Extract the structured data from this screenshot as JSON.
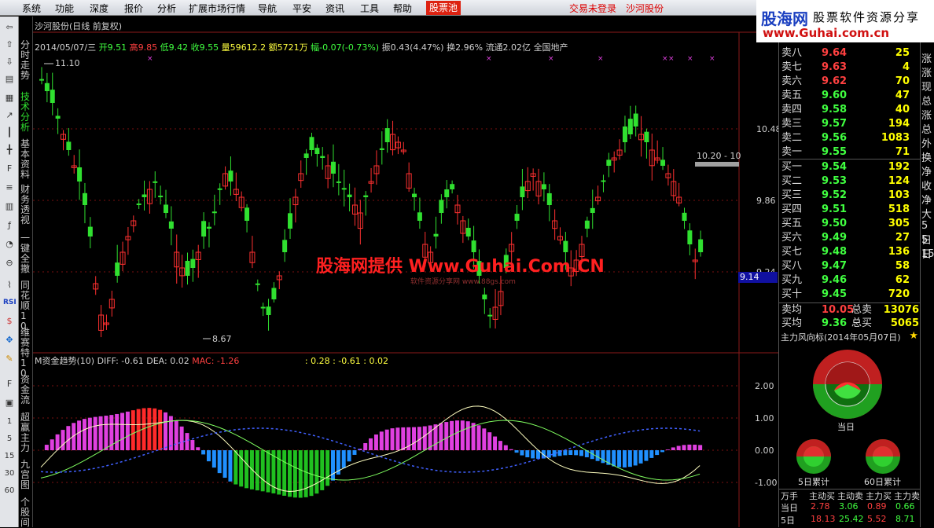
{
  "menu": [
    "系统",
    "功能",
    "深度",
    "报价",
    "分析",
    "扩展市场行情",
    "导航",
    "平安",
    "资讯",
    "工具",
    "帮助"
  ],
  "menu_active": "股票池",
  "menu_red": [
    "交易未登录",
    "沙河股份"
  ],
  "brand": {
    "b1": "股海网",
    "b2": "股票软件资源分享",
    "b3": "www.Guhai.com.cn"
  },
  "side_tabs": [
    "分时走势",
    "技术分析",
    "基本资料",
    "财务透视",
    "一键全撤",
    "同花顺10",
    "维赛特10",
    "资金流",
    "超赢主力",
    "九宫图",
    "个股间"
  ],
  "side_numbers": [
    "1",
    "5",
    "15",
    "30",
    "60"
  ],
  "chart": {
    "title": "沙河股份(日线 前复权)",
    "date": "2014/05/07/三",
    "open": "开9.51",
    "high": "高9.85",
    "low": "低9.42",
    "close": "收9.55",
    "vol": "量59612.2",
    "amt": "额5721万",
    "chg": "幅-0.07(-0.73%)",
    "amp": "振0.43(4.47%)",
    "turn": "换2.96%",
    "flow": "流通2.02亿",
    "sector": "全国地产",
    "price_ticks": [
      "10.48",
      "9.86",
      "9.24"
    ],
    "high_mark": "11.10",
    "low_mark": "8.67",
    "right_label": "10.20 - 10",
    "current_price": "9.14",
    "watermark": "股海网提供 Www.Guhai.Com.CN",
    "watermark2": "软件资源分享网 www.88gs.com",
    "ind_title": "M资金趋势(10)",
    "diff": "DIFF: -0.61",
    "dea": "DEA: 0.02",
    "mac": "MAC: -1.26",
    "extra": ": 0.28  : -0.61  : 0.02",
    "ind_ticks": [
      "2.00",
      "1.00",
      "0.00",
      "-1.00"
    ]
  },
  "quote": {
    "asks": [
      [
        "卖八",
        "9.64",
        "25"
      ],
      [
        "卖七",
        "9.63",
        "4"
      ],
      [
        "卖六",
        "9.62",
        "70"
      ],
      [
        "卖五",
        "9.60",
        "47"
      ],
      [
        "卖四",
        "9.58",
        "40"
      ],
      [
        "卖三",
        "9.57",
        "194"
      ],
      [
        "卖二",
        "9.56",
        "1083"
      ],
      [
        "卖一",
        "9.55",
        "71"
      ]
    ],
    "bids": [
      [
        "买一",
        "9.54",
        "192"
      ],
      [
        "买二",
        "9.53",
        "124"
      ],
      [
        "买三",
        "9.52",
        "103"
      ],
      [
        "买四",
        "9.51",
        "518"
      ],
      [
        "买五",
        "9.50",
        "305"
      ],
      [
        "买六",
        "9.49",
        "27"
      ],
      [
        "买七",
        "9.48",
        "136"
      ],
      [
        "买八",
        "9.47",
        "58"
      ],
      [
        "买九",
        "9.46",
        "62"
      ],
      [
        "买十",
        "9.45",
        "720"
      ]
    ],
    "avg_sell": [
      "卖均",
      "10.05",
      "总卖",
      "13076"
    ],
    "avg_buy": [
      "买均",
      "9.36",
      "总买",
      "5065"
    ],
    "flow_title": "主力风向标(2014年05月07日)",
    "day_label": "当日",
    "d5": "5日累计",
    "d60": "60日累计",
    "table_header": [
      "万手",
      "主动买",
      "主动卖",
      "主力买",
      "主力卖"
    ],
    "table_row": [
      "当日",
      "2.78",
      "3.06",
      "0.89",
      "0.66"
    ],
    "table_row2": [
      "5日",
      "18.13",
      "25.42",
      "5.52",
      "8.71"
    ]
  },
  "far_right": [
    "涨",
    "涨",
    "现",
    "总",
    "涨",
    "总",
    "外",
    "换",
    "净",
    "收",
    "净",
    "大",
    "5日",
    "5日",
    "15"
  ]
}
